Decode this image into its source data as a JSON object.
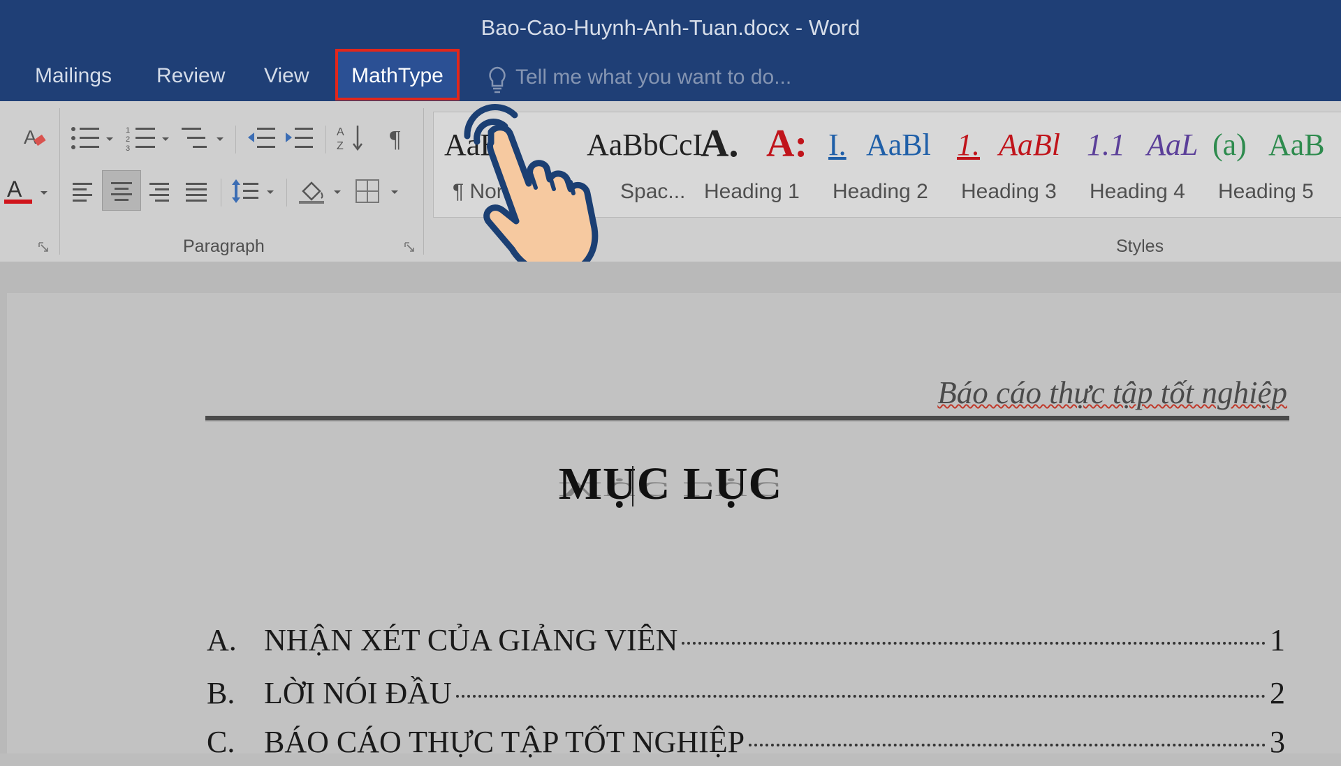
{
  "window": {
    "title": "Bao-Cao-Huynh-Anh-Tuan.docx - Word"
  },
  "tabs": [
    {
      "label": "Mailings"
    },
    {
      "label": "Review"
    },
    {
      "label": "View"
    },
    {
      "label": "MathType"
    }
  ],
  "tell_me": {
    "placeholder": "Tell me what you want to do..."
  },
  "ribbon": {
    "groups": {
      "paragraph": "Paragraph",
      "styles": "Styles"
    },
    "styles": [
      {
        "sample": "AaB",
        "name": "¶ Nor",
        "color": "#222222"
      },
      {
        "sample": "AaBbCcI",
        "name": "Spac...",
        "color": "#222222"
      },
      {
        "sample": "A.",
        "name": "Heading 1",
        "color": "#222222"
      },
      {
        "sample": "A:",
        "name": "Heading 2",
        "color": "#c0141b"
      },
      {
        "sample": "I.",
        "name": "Heading 3",
        "color": "#1f5fa8"
      },
      {
        "sample": "AaBl",
        "name": "Heading 4",
        "color": "#1f5fa8"
      },
      {
        "sample": "1.",
        "name": "Heading 5",
        "color": "#c0141b"
      },
      {
        "sample": "AaBl",
        "name": "",
        "color": "#c0141b"
      },
      {
        "sample": "1.1",
        "name": "",
        "color": "#5b3f99"
      },
      {
        "sample": "AaL",
        "name": "",
        "color": "#5b3f99"
      },
      {
        "sample": "(a)",
        "name": "",
        "color": "#2e8b4e"
      },
      {
        "sample": "AaB",
        "name": "",
        "color": "#2e8b4e"
      }
    ]
  },
  "document": {
    "header": "Báo cáo thực tập tốt nghiệp",
    "toc_title": "MỤC LỤC",
    "toc": [
      {
        "letter": "A.",
        "text": "NHẬN XÉT CỦA GIẢNG VIÊN",
        "page": "1"
      },
      {
        "letter": "B.",
        "text": "LỜI NÓI ĐẦU",
        "page": "2"
      },
      {
        "letter": "C.",
        "text": "BÁO CÁO THỰC TẬP TỐT NGHIỆP",
        "page": "3"
      }
    ]
  },
  "colors": {
    "title_bar": "#1f3f76",
    "highlight_box": "#e2271b",
    "ribbon": "#cfcfcf"
  },
  "icons": {
    "format_painter": "eraser-icon",
    "font_color": "font-color-icon",
    "bullets": "bullets-icon",
    "numbering": "numbering-icon",
    "multilevel": "multilevel-list-icon",
    "decrease_indent": "decrease-indent-icon",
    "increase_indent": "increase-indent-icon",
    "sort": "sort-icon",
    "pilcrow": "pilcrow-icon",
    "align_left": "align-left-icon",
    "align_center": "align-center-icon",
    "align_right": "align-right-icon",
    "justify": "justify-icon",
    "line_spacing": "line-spacing-icon",
    "shading": "shading-icon",
    "borders": "borders-icon",
    "tell_me": "lightbulb-icon",
    "pointer": "hand-pointer-icon"
  }
}
